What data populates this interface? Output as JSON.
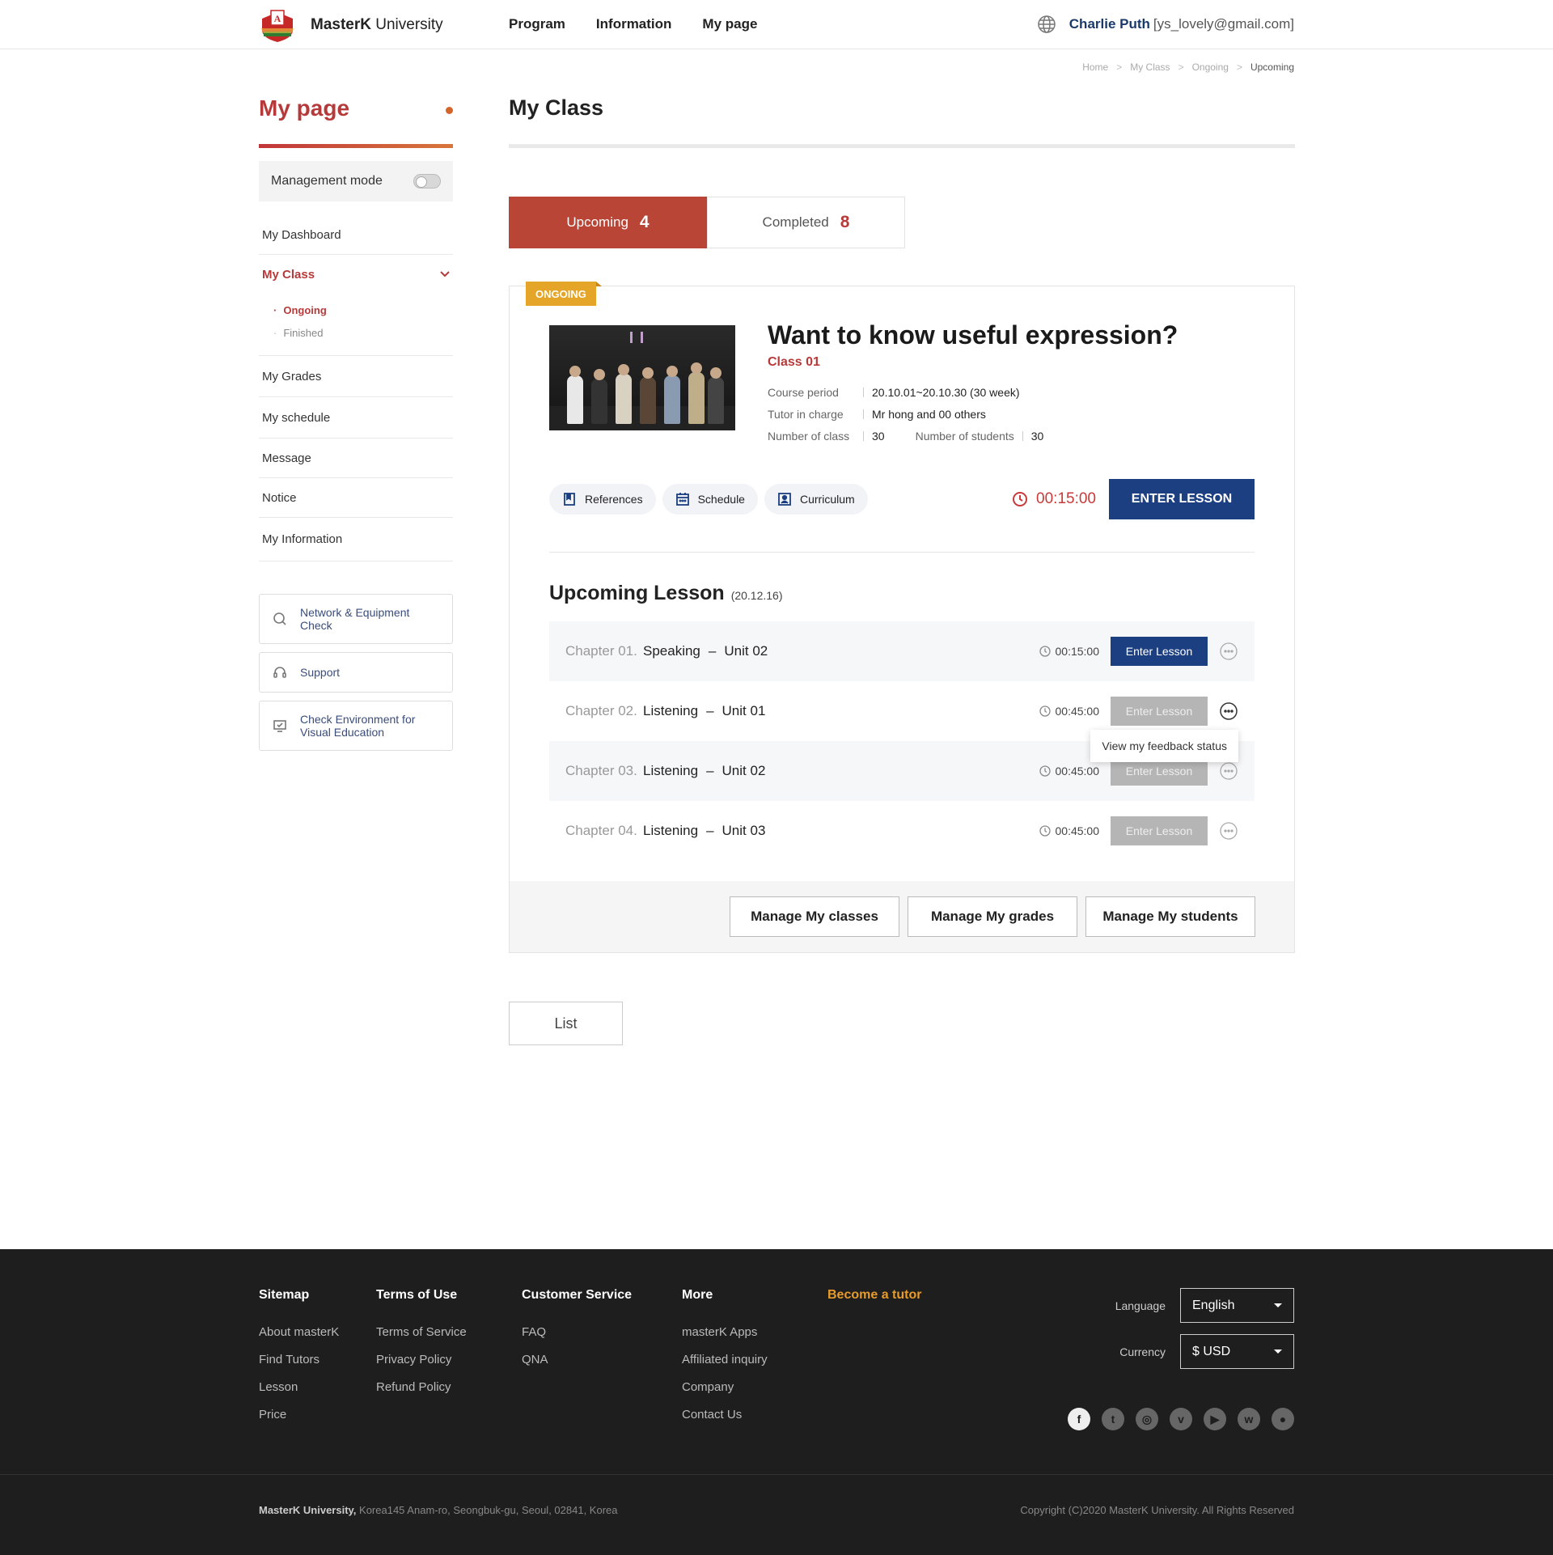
{
  "header": {
    "brand_bold": "MasterK",
    "brand_rest": " University",
    "nav": [
      "Program",
      "Information",
      "My page"
    ],
    "user_name": "Charlie Puth",
    "user_email": "[ys_lovely@gmail.com]"
  },
  "breadcrumb": [
    "Home",
    "My Class",
    "Ongoing",
    "Upcoming"
  ],
  "sidebar": {
    "title": "My page",
    "management_mode": "Management mode",
    "items": [
      "My Dashboard",
      "My Class",
      "My Grades",
      "My schedule",
      "Message",
      "Notice",
      "My Information"
    ],
    "subitems": [
      "Ongoing",
      "Finished"
    ],
    "boxes": [
      "Network & Equipment Check",
      "Support",
      "Check Environment for Visual Education"
    ]
  },
  "main": {
    "title": "My Class",
    "tabs": [
      {
        "label": "Upcoming",
        "count": "4"
      },
      {
        "label": "Completed",
        "count": "8"
      }
    ],
    "card": {
      "badge": "ONGOING",
      "title": "Want to know useful expression?",
      "class_name": "Class 01",
      "course_period_label": "Course period",
      "course_period": "20.10.01~20.10.30  (30 week)",
      "tutor_label": "Tutor in charge",
      "tutor": "Mr hong and 00 others",
      "num_class_label": "Number of class",
      "num_class": "30",
      "num_students_label": "Number of students",
      "num_students": "30",
      "pills": [
        "References",
        "Schedule",
        "Curriculum"
      ],
      "timer": "00:15:00",
      "enter": "ENTER LESSON"
    },
    "upcoming": {
      "title": "Upcoming Lesson",
      "date": "(20.12.16)",
      "lessons": [
        {
          "chapter": "Chapter 01.",
          "subject": "Speaking",
          "unit": "Unit 02",
          "time": "00:15:00",
          "button": "Enter Lesson"
        },
        {
          "chapter": "Chapter 02.",
          "subject": "Listening",
          "unit": "Unit 01",
          "time": "00:45:00",
          "button": "Enter Lesson"
        },
        {
          "chapter": "Chapter 03.",
          "subject": "Listening",
          "unit": "Unit 02",
          "time": "00:45:00",
          "button": "Enter Lesson"
        },
        {
          "chapter": "Chapter 04.",
          "subject": "Listening",
          "unit": "Unit 03",
          "time": "00:45:00",
          "button": "Enter Lesson"
        }
      ],
      "popup": "View my feedback status"
    },
    "manage_buttons": [
      "Manage My classes",
      "Manage My grades",
      "Manage My students"
    ],
    "list_button": "List"
  },
  "footer": {
    "cols": [
      {
        "title": "Sitemap",
        "links": [
          "About masterK",
          "Find Tutors",
          "Lesson",
          "Price"
        ]
      },
      {
        "title": "Terms of Use",
        "links": [
          "Terms of Service",
          "Privacy Policy",
          "Refund Policy"
        ]
      },
      {
        "title": "Customer Service",
        "links": [
          "FAQ",
          "QNA"
        ]
      },
      {
        "title": "More",
        "links": [
          "masterK Apps",
          "Affiliated inquiry",
          "Company",
          "Contact Us"
        ]
      },
      {
        "title": "Become a tutor",
        "links": []
      }
    ],
    "language_label": "Language",
    "language": "English",
    "currency_label": "Currency",
    "currency": "$ USD",
    "address_name": "MasterK University,",
    "address": " Korea145 Anam-ro, Seongbuk-gu, Seoul, 02841, Korea",
    "copyright": "Copyright (C)2020 MasterK University. All Rights Reserved"
  }
}
